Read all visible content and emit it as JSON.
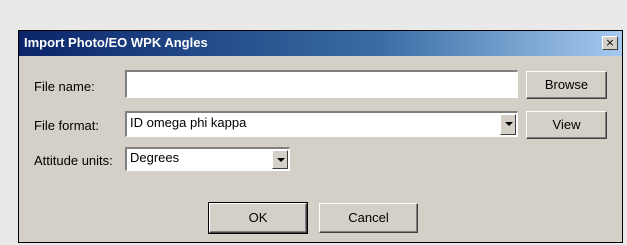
{
  "window": {
    "title": "Import Photo/EO WPK Angles",
    "close_glyph": "×"
  },
  "form": {
    "file_name": {
      "label": "File name:",
      "value": ""
    },
    "file_format": {
      "label": "File format:",
      "value": "ID omega phi kappa"
    },
    "attitude_units": {
      "label": "Attitude units:",
      "value": "Degrees"
    }
  },
  "buttons": {
    "browse": "Browse",
    "view": "View",
    "ok": "OK",
    "cancel": "Cancel"
  },
  "colors": {
    "titlebar_start": "#0a246a",
    "titlebar_end": "#a6caf0",
    "dialog_bg": "#d4d0c8"
  },
  "icons": {
    "close": "close-icon",
    "dropdown": "chevron-down-icon"
  }
}
